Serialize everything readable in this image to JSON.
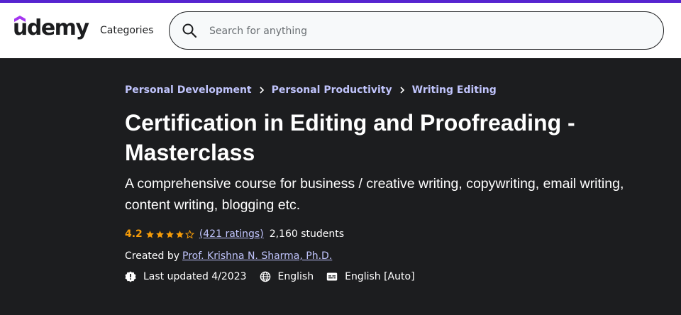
{
  "brand": {
    "logo_text": "udemy",
    "accent_color": "#5624d0"
  },
  "header": {
    "categories_label": "Categories",
    "search_placeholder": "Search for anything",
    "search_value": ""
  },
  "breadcrumb": [
    {
      "label": "Personal Development"
    },
    {
      "label": "Personal Productivity"
    },
    {
      "label": "Writing Editing"
    }
  ],
  "course": {
    "title": "Certification in Editing and Proofreading - Masterclass",
    "subtitle": "A comprehensive course for business / creative writing, copywriting, email writing, content writing, blogging etc.",
    "rating": "4.2",
    "rating_stars": 4,
    "ratings_count_label": "(421 ratings)",
    "students_label": "2,160 students",
    "created_by_label": "Created by",
    "instructor": "Prof. Krishna N. Sharma, Ph.D.",
    "last_updated": "Last updated 4/2023",
    "language": "English",
    "captions": "English [Auto]"
  },
  "icons": {
    "search": "search-icon",
    "chevron": "chevron-right-icon",
    "star_filled": "star-filled-icon",
    "star_empty": "star-outline-icon",
    "updated": "alert-badge-icon",
    "language": "globe-icon",
    "captions": "closed-captions-icon"
  },
  "colors": {
    "hero_bg": "#1c1d1f",
    "link": "#c0c4fc",
    "rating": "#f69c08"
  }
}
